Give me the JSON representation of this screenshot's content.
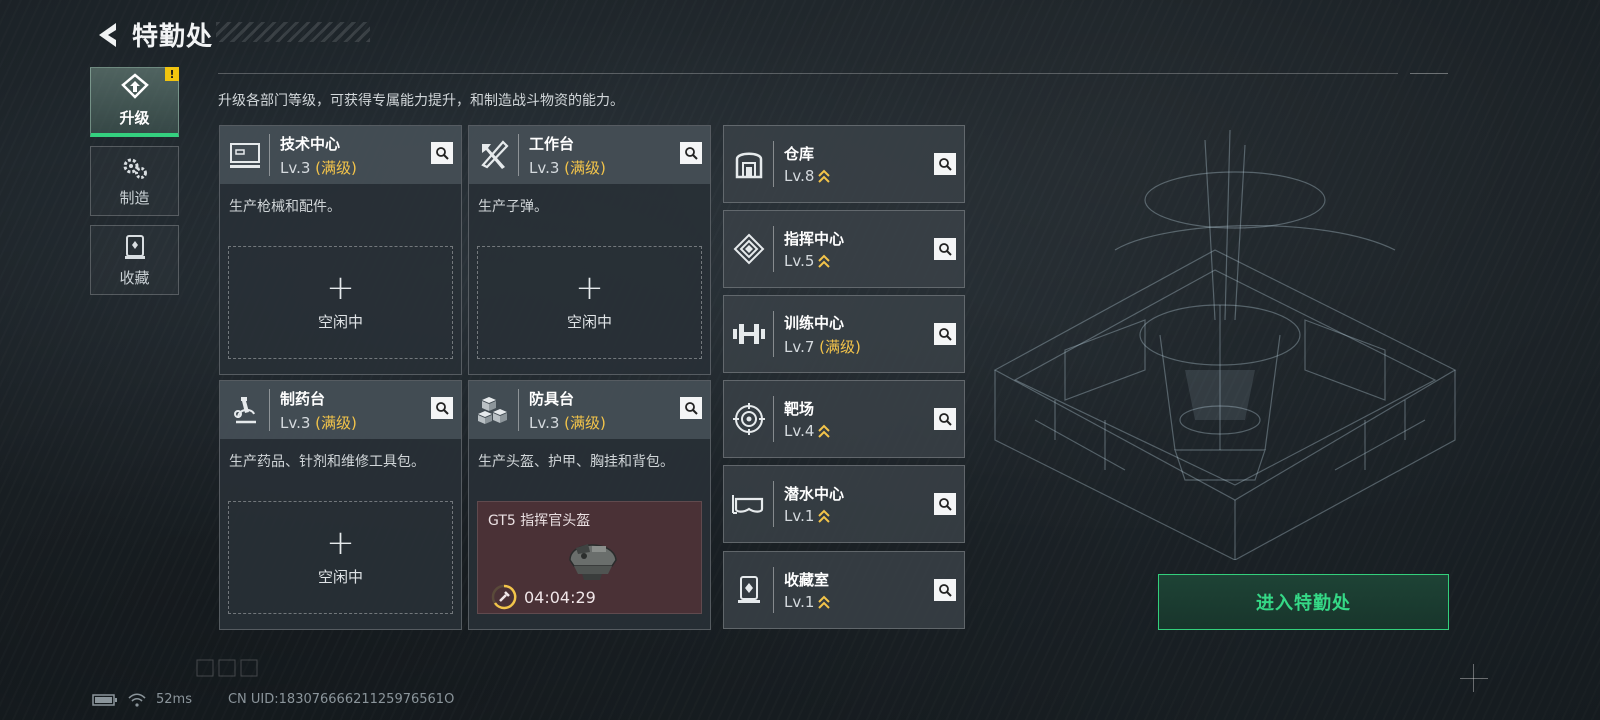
{
  "header": {
    "title": "特勤处"
  },
  "nav": [
    {
      "label": "升级",
      "icon": "upgrade-icon",
      "active": true,
      "badge": "!"
    },
    {
      "label": "制造",
      "icon": "gears-icon",
      "active": false
    },
    {
      "label": "收藏",
      "icon": "collection-icon",
      "active": false
    }
  ],
  "description": "升级各部门等级，可获得专属能力提升，和制造战斗物资的能力。",
  "stations": [
    {
      "name": "技术中心",
      "level": "Lv.3",
      "maxed": "(满级)",
      "desc": "生产枪械和配件。",
      "slot_label": "空闲中",
      "icon": "monitor-icon"
    },
    {
      "name": "工作台",
      "level": "Lv.3",
      "maxed": "(满级)",
      "desc": "生产子弹。",
      "slot_label": "空闲中",
      "icon": "tools-icon"
    },
    {
      "name": "制药台",
      "level": "Lv.3",
      "maxed": "(满级)",
      "desc": "生产药品、针剂和维修工具包。",
      "slot_label": "空闲中",
      "icon": "microscope-icon"
    },
    {
      "name": "防具台",
      "level": "Lv.3",
      "maxed": "(满级)",
      "desc": "生产头盔、护甲、胸挂和背包。",
      "icon": "cubes-icon",
      "crafting": {
        "item_name": "GT5 指挥官头盔",
        "timer": "04:04:29",
        "icon": "helmet-icon"
      }
    }
  ],
  "facilities": [
    {
      "name": "仓库",
      "level": "Lv.8",
      "maxed": "",
      "icon": "warehouse-icon",
      "upgradable": true
    },
    {
      "name": "指挥中心",
      "level": "Lv.5",
      "maxed": "",
      "icon": "command-icon",
      "upgradable": true
    },
    {
      "name": "训练中心",
      "level": "Lv.7",
      "maxed": "(满级)",
      "icon": "dumbbell-icon",
      "upgradable": false
    },
    {
      "name": "靶场",
      "level": "Lv.4",
      "maxed": "",
      "icon": "target-icon",
      "upgradable": true
    },
    {
      "name": "潜水中心",
      "level": "Lv.1",
      "maxed": "",
      "icon": "diving-mask-icon",
      "upgradable": true
    },
    {
      "name": "收藏室",
      "level": "Lv.1",
      "maxed": "",
      "icon": "collection-room-icon",
      "upgradable": true
    }
  ],
  "enter_button": "进入特勤处",
  "status": {
    "ping": "52ms",
    "uid": "CN UID:18307666621125976561O"
  },
  "colors": {
    "accent_green": "#34d07f",
    "maxed_gold": "#f3c44a",
    "craft_bg": "#4a3136"
  }
}
